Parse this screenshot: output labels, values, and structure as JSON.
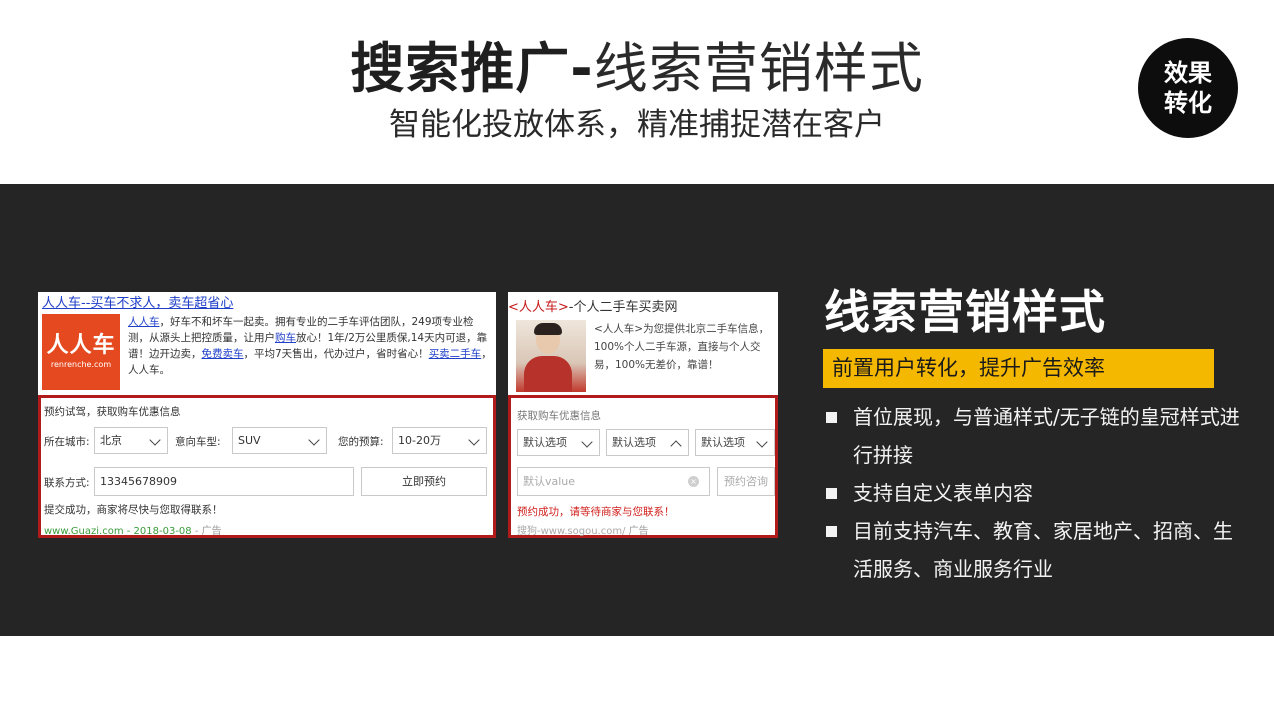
{
  "header": {
    "title_strong": "搜索推广-",
    "title_light": "线索营销样式",
    "subtitle": "智能化投放体系，精准捕捉潜在客户",
    "badge_line1": "效果",
    "badge_line2": "转化"
  },
  "panel_left": {
    "ad_title": "人人车--买车不求人，卖车超省心",
    "logo_text": "人人车",
    "logo_domain": "renrenche.com",
    "desc_link1": "人人车",
    "desc_part1": "，好车不和坏车一起卖。拥有专业的二手车评估团队，249项专业检测，从源头上把控质量，让用户",
    "desc_link2": "购车",
    "desc_part2": "放心！1年/2万公里质保,14天内可退，靠谱！边开边卖，",
    "desc_link3": "免费卖车",
    "desc_part3": "，平均7天售出，代办过户，省时省心！",
    "desc_link4": "买卖二手车",
    "desc_part4": "，人人车。",
    "form_heading": "预约试驾，获取购车优惠信息",
    "city_label": "所在城市:",
    "city_value": "北京",
    "model_label": "意向车型:",
    "model_value": "SUV",
    "budget_label": "您的预算:",
    "budget_value": "10-20万",
    "contact_label": "联系方式:",
    "contact_value": "13345678909",
    "submit_label": "立即预约",
    "success_text": "提交成功，商家将尽快与您取得联系！",
    "url_text": "www.Guazi.com - 2018-03-08",
    "ad_tag": "- 广告"
  },
  "panel_right": {
    "ad_title_red": "<人人车>",
    "ad_title_rest": "-个人二手车买卖网",
    "desc": "<人人车>为您提供北京二手车信息，100%个人二手车源，直接与个人交易，100%无差价，靠谱！",
    "form_heading": "获取购车优惠信息",
    "select1": "默认选项",
    "select2": "默认选项",
    "select3": "默认选项",
    "input_placeholder": "默认value",
    "consult_label": "预约咨询",
    "success_text": "预约成功，请等待商家与您联系！",
    "url_text": "搜狗-www.sogou.com/",
    "ad_tag": "广告"
  },
  "right": {
    "title": "线索营销样式",
    "subtitle": "前置用户转化，提升广告效率",
    "bullets": [
      "首位展现，与普通样式/无子链的皇冠样式进行拼接",
      "支持自定义表单内容",
      "目前支持汽车、教育、家居地产、招商、生活服务、商业服务行业"
    ]
  },
  "colors": {
    "band": "#252525",
    "accent": "#f5b800",
    "form_border": "#b11a1a",
    "logo": "#e5491f"
  }
}
